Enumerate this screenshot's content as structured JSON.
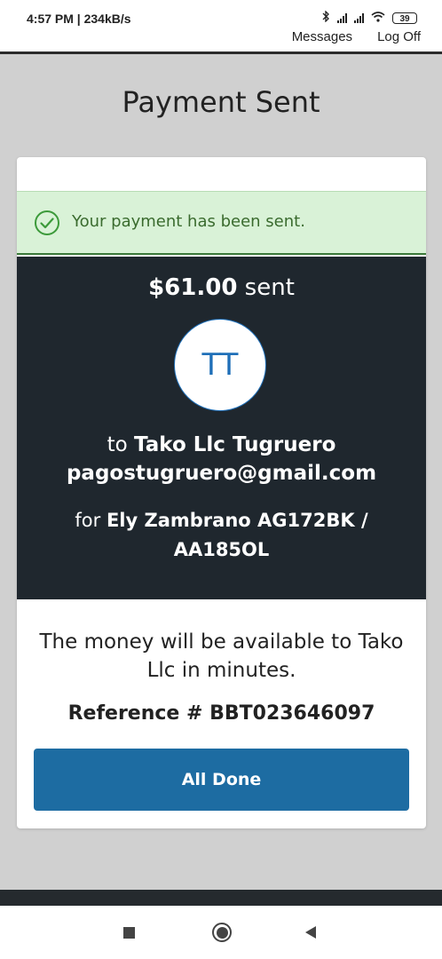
{
  "status_bar": {
    "time": "4:57 PM | 234kB/s",
    "battery": "39"
  },
  "top_nav": {
    "messages": "Messages",
    "logout": "Log Off"
  },
  "page": {
    "title": "Payment Sent"
  },
  "alert": {
    "message": "Your payment has been sent.",
    "icon": "check-circle-icon"
  },
  "summary": {
    "amount": "$61.00",
    "sent_suffix": " sent",
    "avatar_initials": "TT",
    "to_prefix": "to ",
    "recipient_name": "Tako Llc Tugruero",
    "recipient_email": "pagostugruero@gmail.com",
    "for_prefix": "for ",
    "memo": "Ely Zambrano AG172BK / AA185OL"
  },
  "details": {
    "availability": "The money will be available to Tako Llc in minutes.",
    "reference": "Reference # BBT023646097"
  },
  "actions": {
    "done_label": "All Done"
  },
  "colors": {
    "alert_bg": "#d9f2d7",
    "alert_text": "#3a6b2e",
    "panel_bg": "#1f272e",
    "primary_button": "#1d6ca2",
    "avatar_text": "#1f6fb8"
  }
}
